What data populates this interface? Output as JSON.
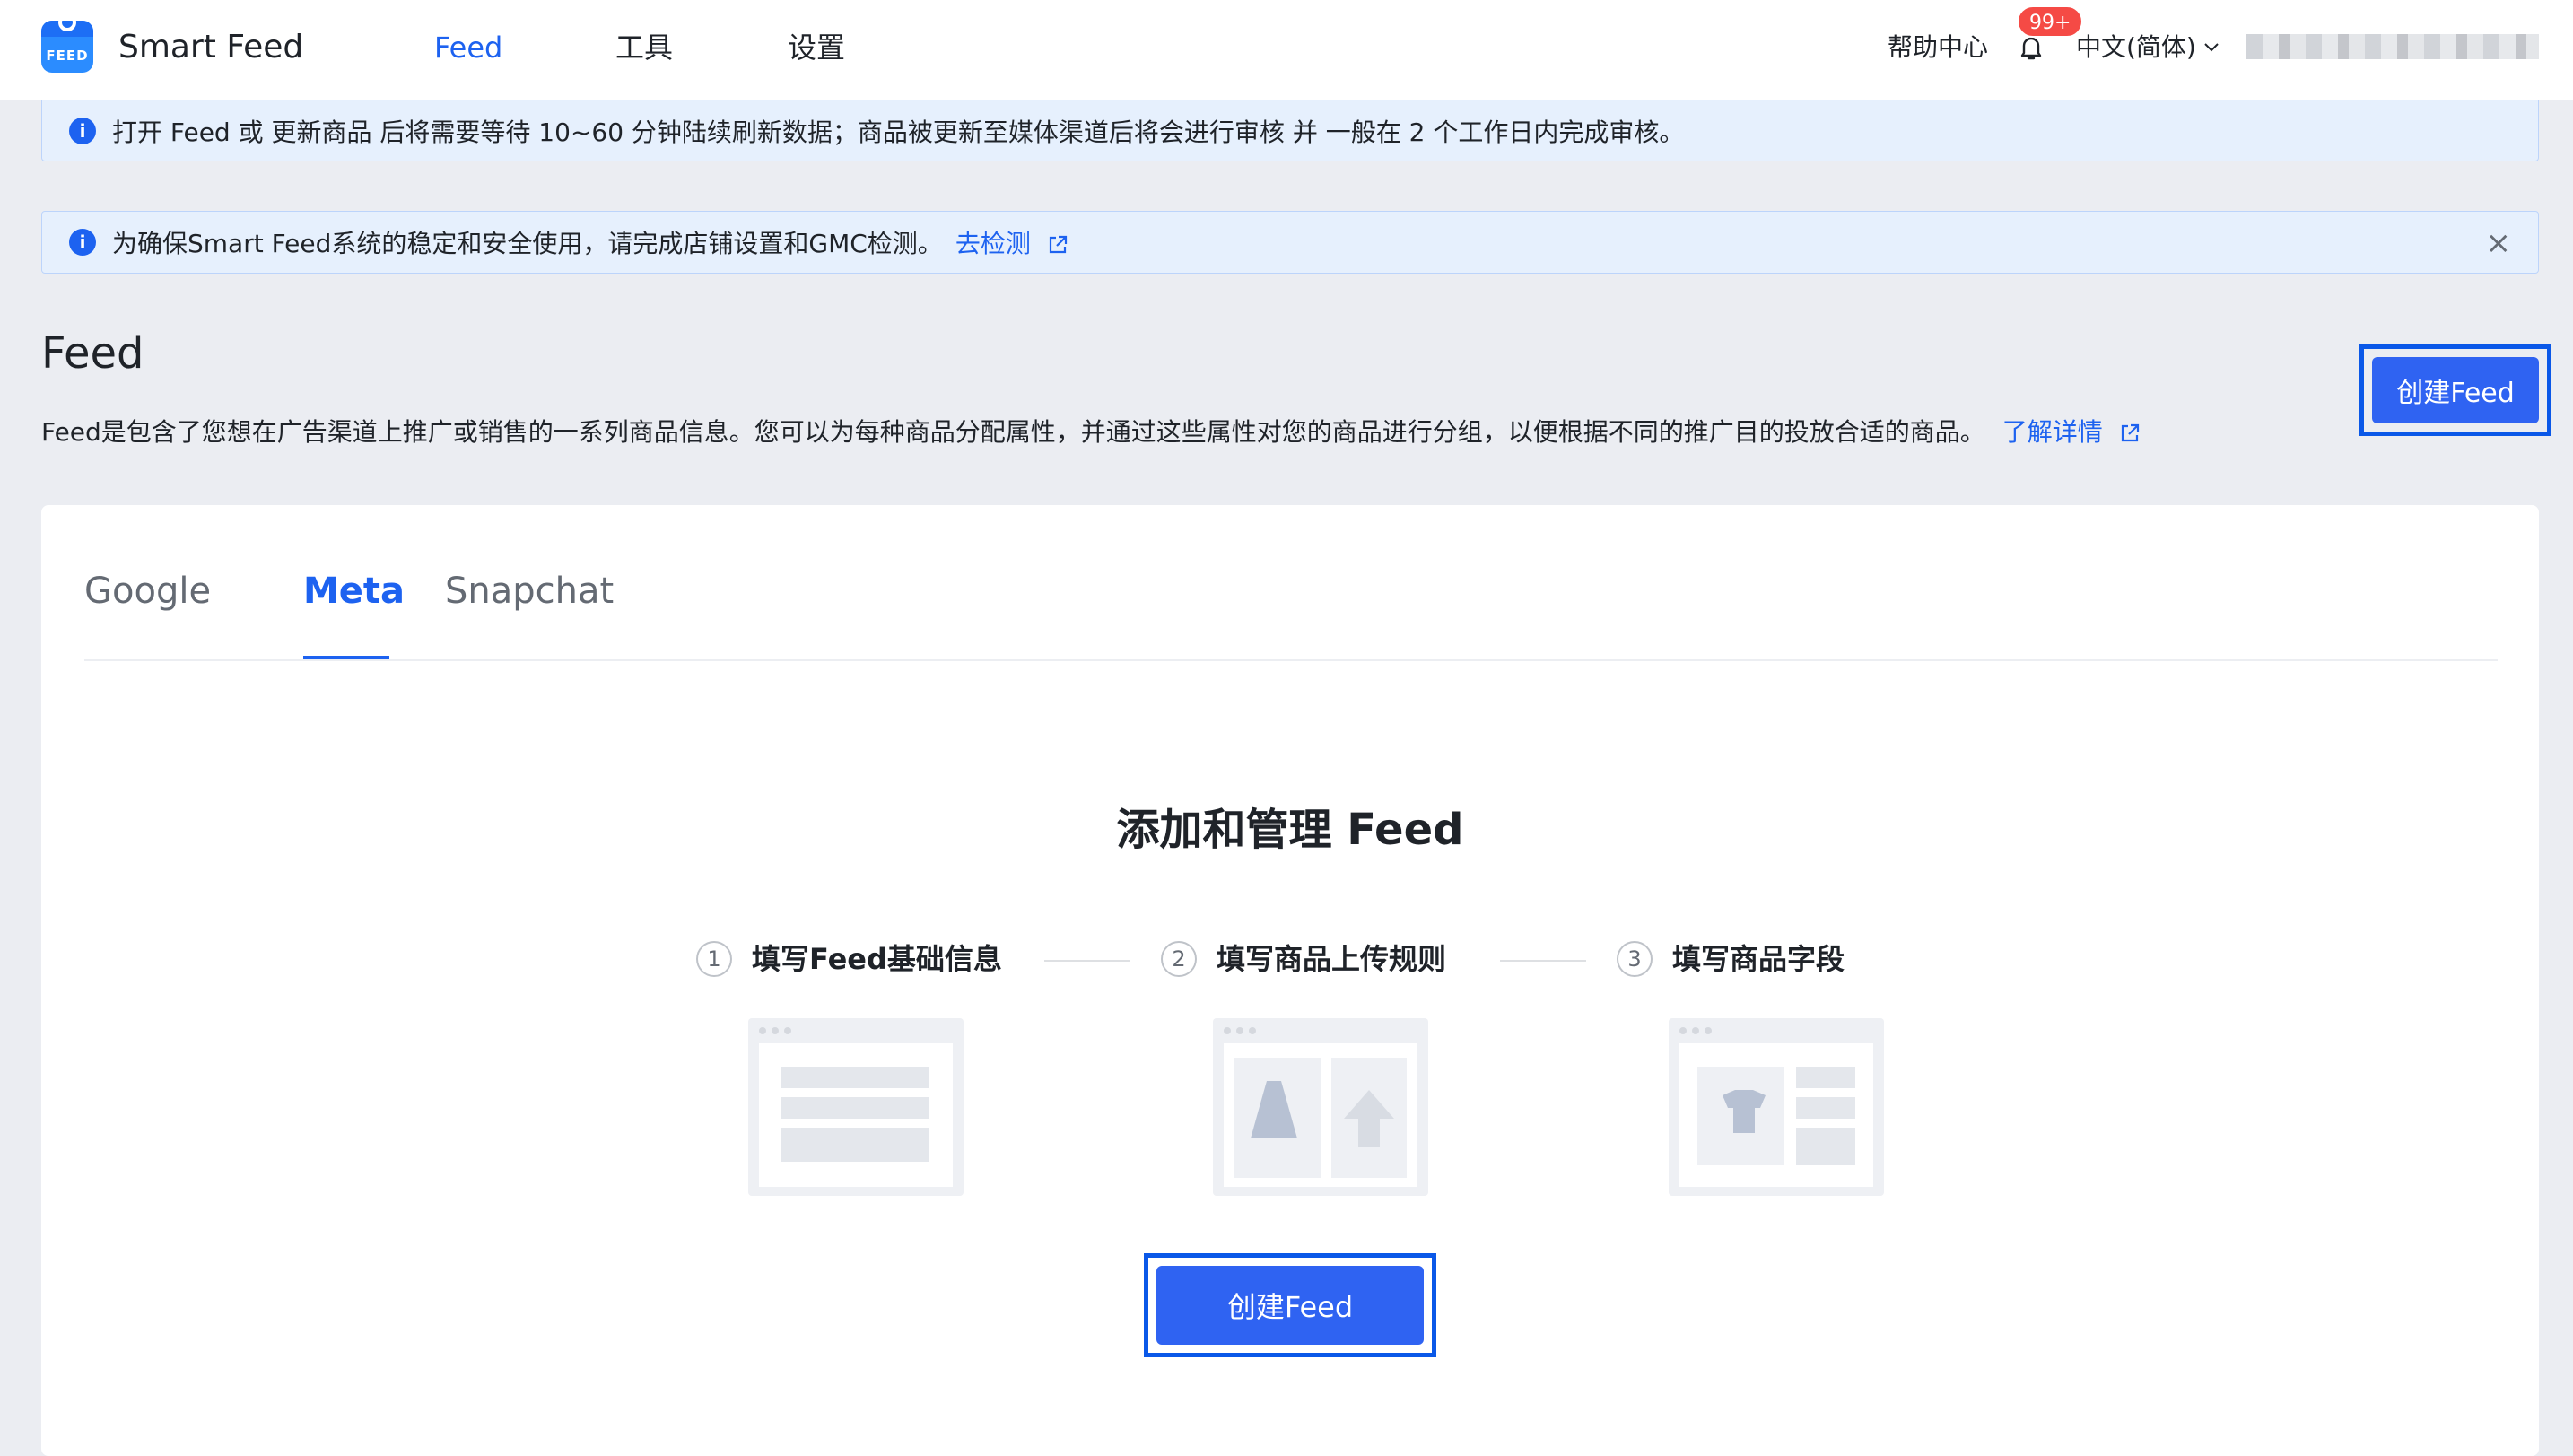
{
  "app": {
    "logo_text": "FEED",
    "title": "Smart Feed"
  },
  "nav": {
    "items": [
      {
        "label": "Feed",
        "active": true
      },
      {
        "label": "工具",
        "active": false
      },
      {
        "label": "设置",
        "active": false
      }
    ],
    "help": "帮助中心",
    "notification_badge": "99+",
    "language": "中文(简体)"
  },
  "alerts": {
    "sync_notice": "打开 Feed 或 更新商品 后将需要等待 10~60 分钟陆续刷新数据；商品被更新至媒体渠道后将会进行审核 并 一般在 2 个工作日内完成审核。",
    "check_notice": "为确保Smart Feed系统的稳定和安全使用，请完成店铺设置和GMC检测。",
    "check_link": "去检测"
  },
  "header": {
    "title": "Feed",
    "description": "Feed是包含了您想在广告渠道上推广或销售的一系列商品信息。您可以为每种商品分配属性，并通过这些属性对您的商品进行分组，以便根据不同的推广目的投放合适的商品。",
    "learn_more": "了解详情",
    "create_button": "创建Feed"
  },
  "tabs": [
    {
      "label": "Google",
      "active": false
    },
    {
      "label": "Meta",
      "active": true
    },
    {
      "label": "Snapchat",
      "active": false
    }
  ],
  "empty_state": {
    "title": "添加和管理 Feed",
    "steps": [
      {
        "number": "1",
        "label": "填写Feed基础信息"
      },
      {
        "number": "2",
        "label": "填写商品上传规则"
      },
      {
        "number": "3",
        "label": "填写商品字段"
      }
    ],
    "create_button": "创建Feed"
  },
  "colors": {
    "primary": "#2f63f2",
    "link": "#1d62f0",
    "badge": "#f54a45",
    "alert_bg": "#e6f0fd",
    "focus_frame": "#0a58e8"
  }
}
